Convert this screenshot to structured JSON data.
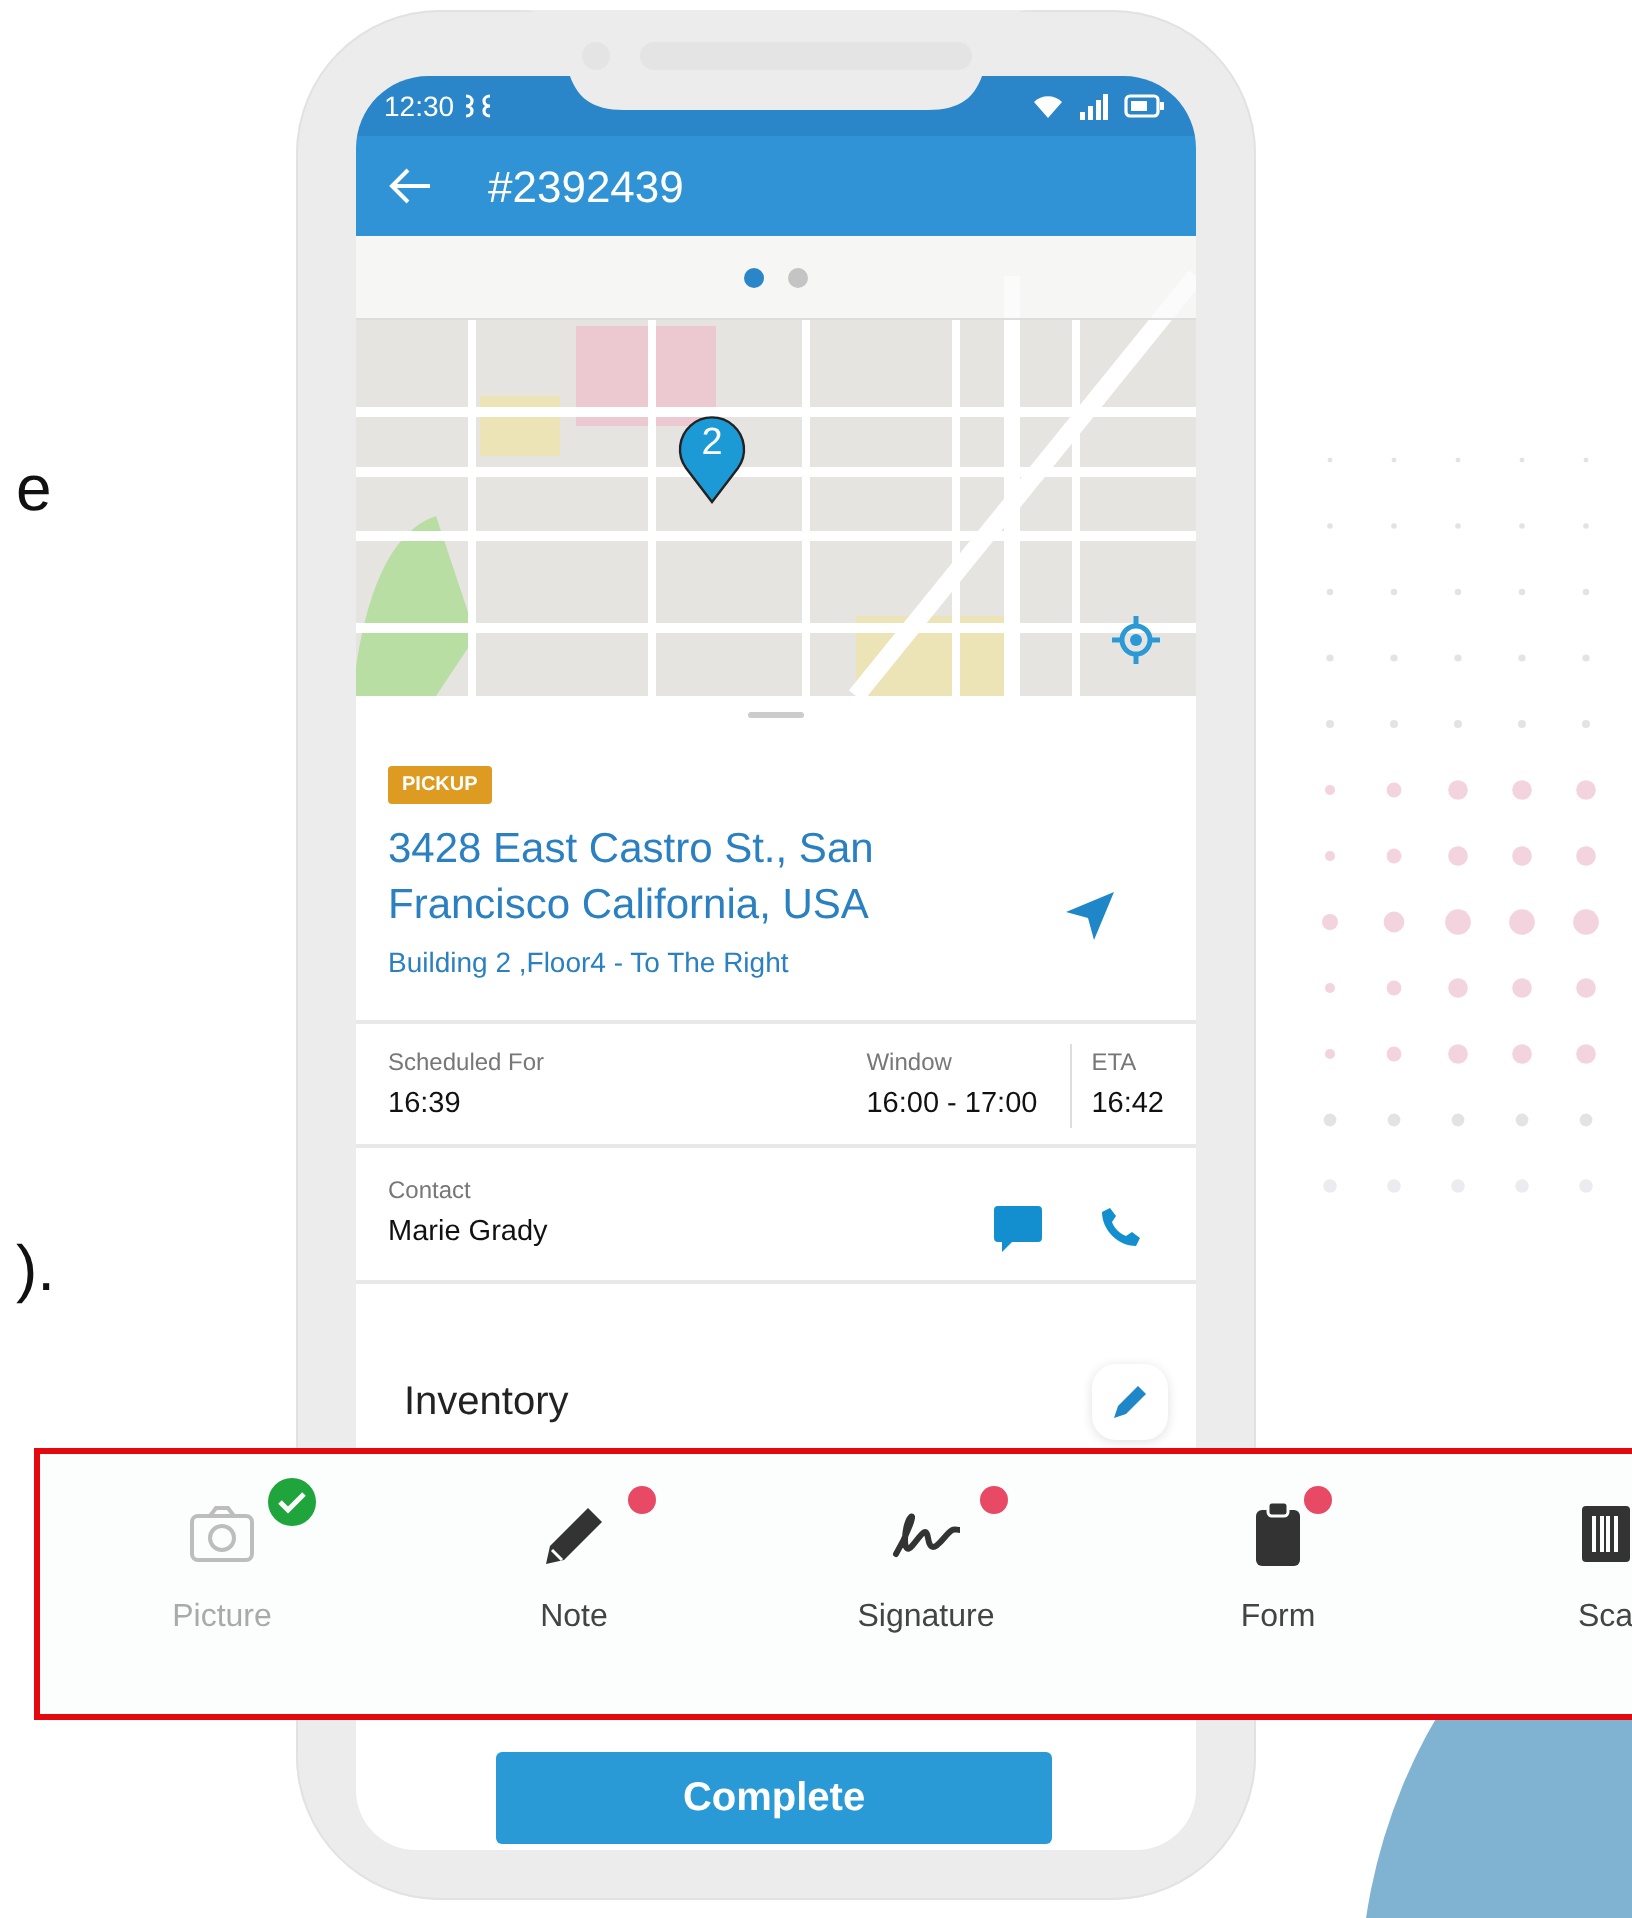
{
  "side_texts": [
    {
      "text": "e"
    },
    {
      "text": ")."
    }
  ],
  "status_bar": {
    "time": "12:30"
  },
  "app_bar": {
    "title": "#2392439"
  },
  "map": {
    "pin": "2",
    "pages": [
      {
        "selected": true
      },
      {
        "selected": false
      }
    ]
  },
  "stop": {
    "type": "PICKUP",
    "address": "3428 East Castro St., San Francisco California, USA",
    "note": "Building 2 ,Floor4 - To The Right"
  },
  "schedule": [
    {
      "label": "Scheduled For",
      "value": "16:39"
    },
    {
      "label": "Window",
      "value": "16:00 - 17:00"
    },
    {
      "label": "ETA",
      "value": "16:42"
    }
  ],
  "contact": {
    "label": "Contact",
    "name": "Marie Grady"
  },
  "inventory": {
    "title": "Inventory"
  },
  "toolbar": [
    {
      "label": "Picture",
      "kind": "camera",
      "done": true
    },
    {
      "label": "Note",
      "kind": "pencil",
      "done": false
    },
    {
      "label": "Signature",
      "kind": "signature",
      "done": false
    },
    {
      "label": "Form",
      "kind": "clipboard",
      "done": false
    },
    {
      "label": "Sca",
      "kind": "barcode"
    }
  ],
  "complete_button": "Complete"
}
